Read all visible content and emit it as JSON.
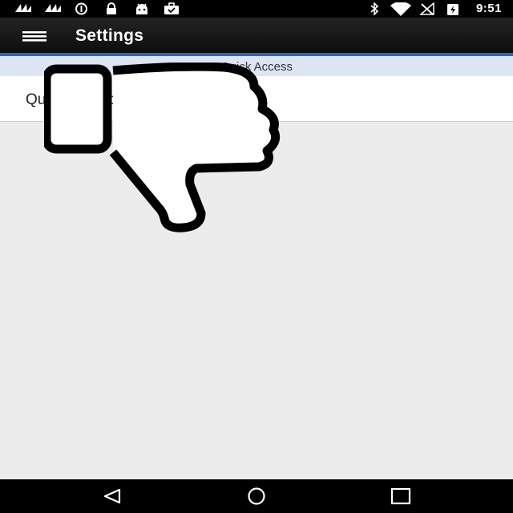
{
  "status_bar": {
    "time": "9:51",
    "left_icons": [
      "signal-icon",
      "signal-icon",
      "data-saver-icon",
      "lock-icon",
      "android-icon",
      "briefcase-icon"
    ],
    "right_icons": [
      "bluetooth-icon",
      "wifi-icon",
      "no-sim-icon",
      "battery-charging-icon"
    ]
  },
  "app_bar": {
    "title": "Settings",
    "menu_icon": "menu-icon"
  },
  "section_header": {
    "label": "Quick Access"
  },
  "list": {
    "items": [
      {
        "label": "Quick Balance"
      }
    ]
  },
  "overlay": {
    "icon": "thumbs-down-icon"
  },
  "nav_bar": {
    "buttons": [
      "back-icon",
      "home-icon",
      "recents-icon"
    ]
  },
  "colors": {
    "accent": "#2f63c2",
    "section_header_bg": "#dde5f2",
    "app_bar_bg": "#141414",
    "content_bg": "#ececec"
  }
}
